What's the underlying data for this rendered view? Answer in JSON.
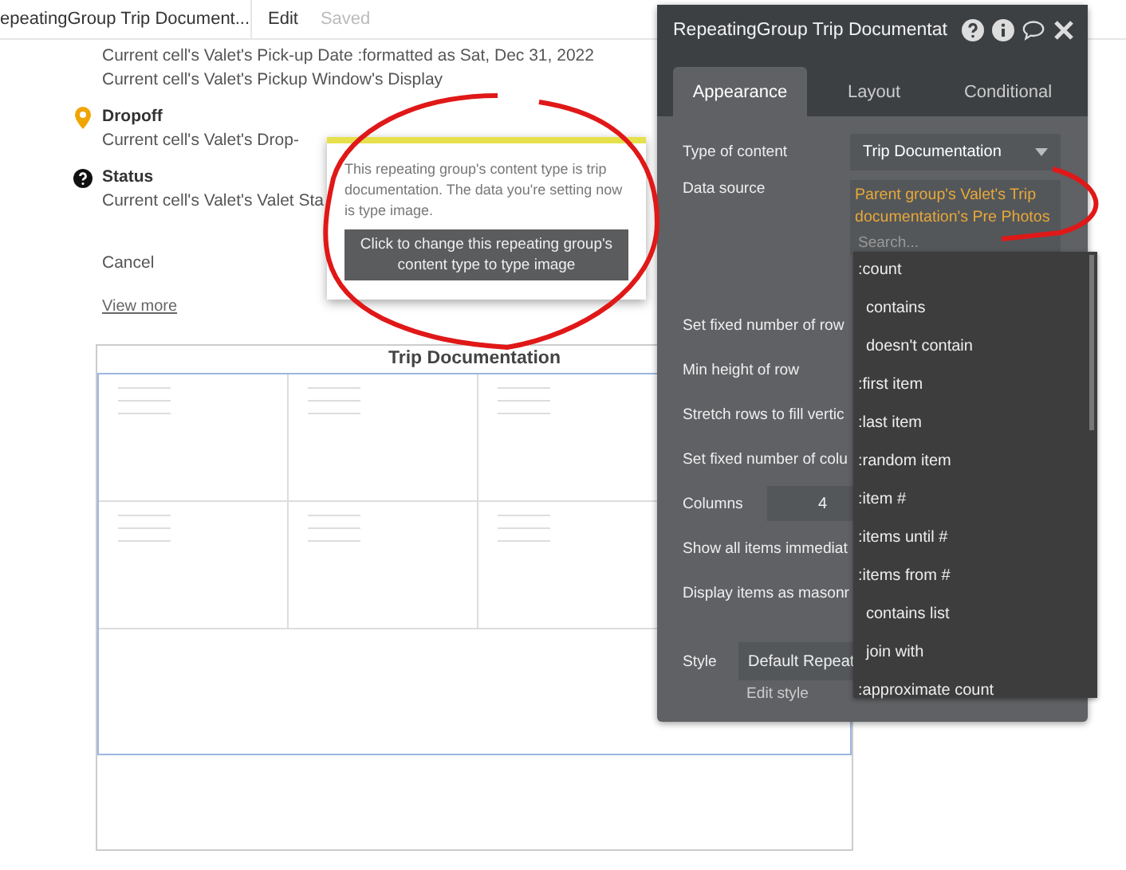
{
  "topbar": {
    "title": "epeatingGroup Trip Document...",
    "edit": "Edit",
    "saved": "Saved"
  },
  "sections": [
    {
      "kind": "plain",
      "lines": [
        "Current cell's Valet's Pick-up Date :formatted as Sat, Dec 31, 2022",
        "Current cell's Valet's Pickup Window's Display"
      ]
    },
    {
      "kind": "place",
      "heading": "Dropoff",
      "lines": [
        "Current cell's Valet's Drop-"
      ]
    },
    {
      "kind": "status",
      "heading": "Status",
      "lines": [
        "Current cell's Valet's Valet Sta"
      ]
    }
  ],
  "cancel": "Cancel",
  "view_more": "View more",
  "grid": {
    "title": "Trip Documentation"
  },
  "tooltip": {
    "message": "This repeating group's content type is trip documentation. The data you're setting now is type image.",
    "button": "Click to change this repeating group's content type to type image"
  },
  "panel": {
    "title": "RepeatingGroup Trip Documentat",
    "tabs": [
      {
        "label": "Appearance",
        "selected": true
      },
      {
        "label": "Layout",
        "selected": false
      },
      {
        "label": "Conditional",
        "selected": false
      }
    ],
    "fields": [
      {
        "kind": "select",
        "label": "Type of content",
        "value": "Trip Documentation"
      },
      {
        "kind": "source",
        "label": "Data source",
        "value": "Parent group's Valet's Trip documentation's Pre Photos",
        "placeholder": "Search..."
      },
      {
        "kind": "label",
        "label": "Set fixed number of row"
      },
      {
        "kind": "label",
        "label": "Min height of row"
      },
      {
        "kind": "label",
        "label": "Stretch rows to fill vertic"
      },
      {
        "kind": "label",
        "label": "Set fixed number of colu"
      },
      {
        "kind": "number",
        "label": "Columns",
        "value": "4"
      },
      {
        "kind": "label",
        "label": "Show all items immediat"
      },
      {
        "kind": "label",
        "label": "Display items as masonr"
      },
      {
        "kind": "style",
        "label": "Style",
        "value": "Default Repeat",
        "link": "Edit style"
      }
    ]
  },
  "menu": {
    "items": [
      ":count",
      "contains",
      "doesn't contain",
      ":first item",
      ":last item",
      ":random item",
      ":item #",
      ":items until #",
      ":items from #",
      "contains list",
      "join with",
      ":approximate count"
    ]
  }
}
